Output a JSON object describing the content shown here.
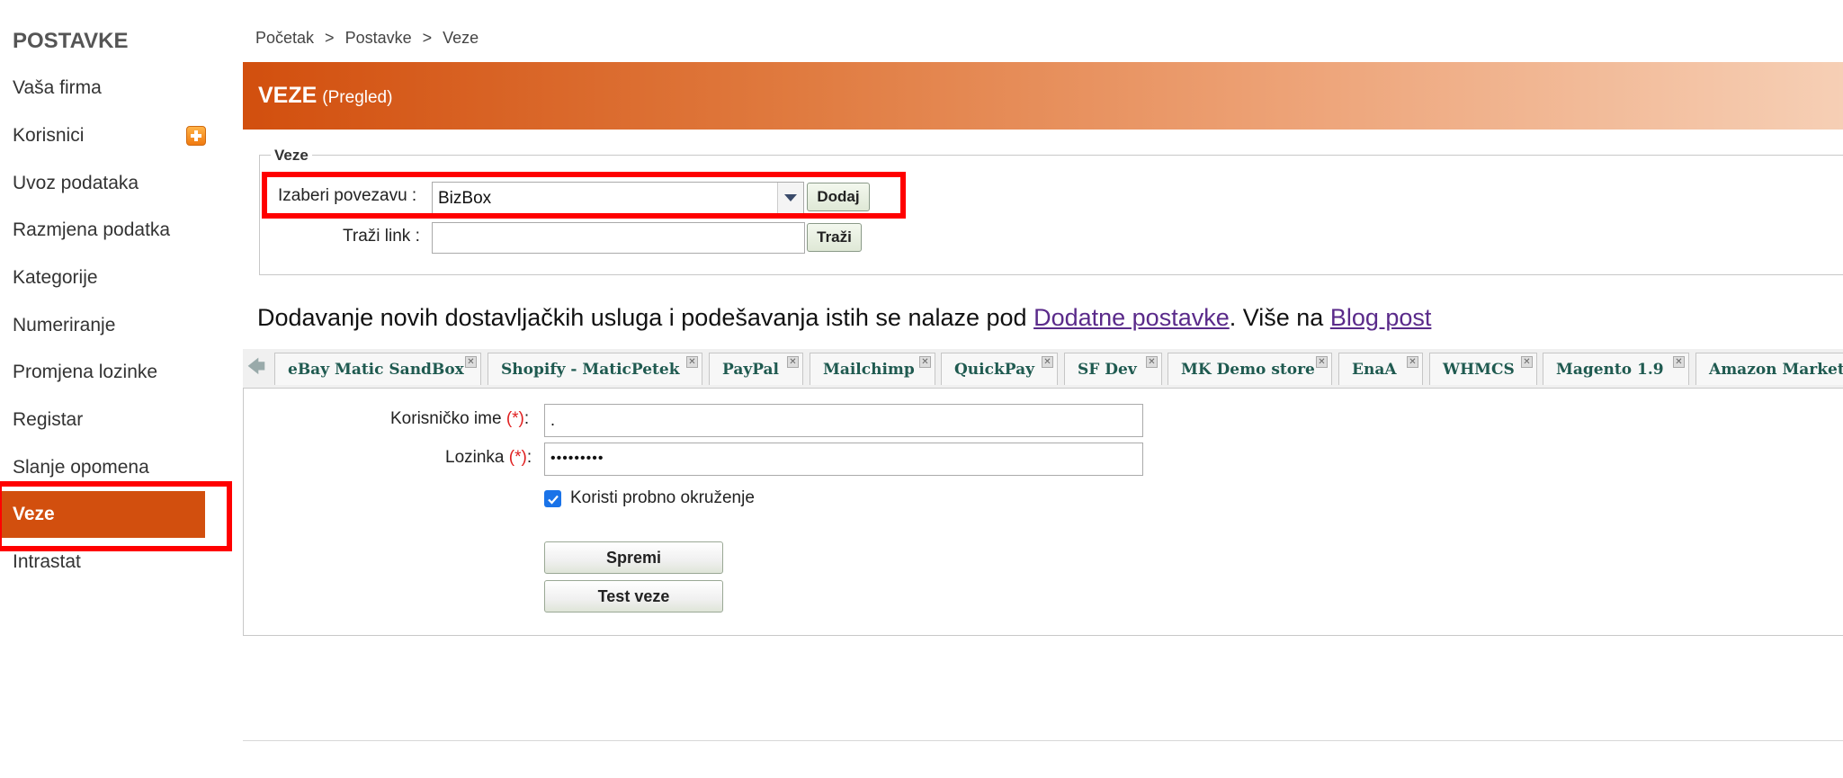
{
  "sidebar": {
    "title": "POSTAVKE",
    "items": [
      {
        "label": "Vaša firma"
      },
      {
        "label": "Korisnici"
      },
      {
        "label": "Uvoz podataka"
      },
      {
        "label": "Razmjena podatka"
      },
      {
        "label": "Kategorije"
      },
      {
        "label": "Numeriranje"
      },
      {
        "label": "Promjena lozinke"
      },
      {
        "label": "Registar"
      },
      {
        "label": "Slanje opomena"
      },
      {
        "label": "Veze",
        "active": true
      },
      {
        "label": "Intrastat"
      }
    ]
  },
  "breadcrumb": [
    "Početak",
    "Postavke",
    "Veze"
  ],
  "breadcrumb_separator": ">",
  "header": {
    "title": "VEZE",
    "subtitle": "(Pregled)"
  },
  "connections": {
    "legend": "Veze",
    "select_label": "Izaberi povezavu :",
    "select_value": "BizBox",
    "add_button": "Dodaj",
    "search_label": "Traži link :",
    "search_value": "",
    "search_button": "Traži"
  },
  "info": {
    "text": "Dodavanje novih dostavljačkih usluga i podešavanja istih se nalaze pod ",
    "link1": "Dodatne postavke",
    "middle": ". Više na ",
    "link2": "Blog post"
  },
  "tabs": [
    "eBay Matic SandBox",
    "Shopify - MaticPetek",
    "PayPal",
    "Mailchimp",
    "QuickPay",
    "SF Dev",
    "MK Demo store",
    "EnaA",
    "WHMCS",
    "Magento 1.9",
    "Amazon Marketp"
  ],
  "form": {
    "username_label": "Korisničko ime",
    "username_value": ".",
    "password_label": "Lozinka",
    "password_value": "•••••••••",
    "required_mark": "(*)",
    "label_suffix": ":",
    "checkbox_label": "Koristi probno okruženje",
    "checkbox_checked": true,
    "save_button": "Spremi",
    "test_button": "Test veze"
  },
  "colors": {
    "accent": "#d24f0e",
    "highlight": "#ff0000",
    "tab_text": "#1f5a50",
    "link": "#5a2a8a"
  }
}
